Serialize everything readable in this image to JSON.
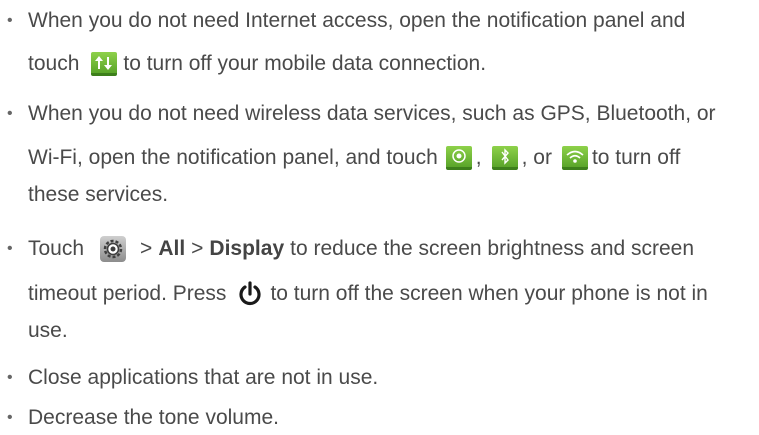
{
  "items": [
    {
      "lines": [
        {
          "t1": "When you do not need Internet access, open the notification panel and"
        },
        {
          "t1": "touch",
          "t2": "to turn off your mobile data connection."
        }
      ]
    },
    {
      "lines": [
        {
          "t1": "When you do not need wireless data services, such as GPS, Bluetooth, or"
        },
        {
          "t1": "Wi-Fi, open the notification panel, and touch",
          "sep1": ",",
          "sep2": ", or",
          "t2": "to turn off"
        },
        {
          "t1": "these services."
        }
      ]
    },
    {
      "lines": [
        {
          "t1": "Touch",
          "sep1": ">",
          "bold1": "All",
          "sep2": ">",
          "bold2": "Display",
          "t2": "to reduce the screen brightness and screen"
        },
        {
          "t1": "timeout period. Press",
          "t2": "to turn off the screen when your phone is not in"
        },
        {
          "t1": "use."
        }
      ]
    },
    {
      "lines": [
        {
          "t1": "Close applications that are not in use."
        }
      ]
    },
    {
      "lines": [
        {
          "t1": "Decrease the tone volume."
        }
      ]
    }
  ],
  "bullet": "•",
  "icons": {
    "mobile_data": "mobile-data-icon",
    "gps": "gps-icon",
    "bluetooth": "bluetooth-icon",
    "wifi": "wifi-icon",
    "settings": "settings-gear-icon",
    "power": "power-icon"
  },
  "colors": {
    "text": "#4a4a4a",
    "icon_green": "#6fbe35"
  }
}
